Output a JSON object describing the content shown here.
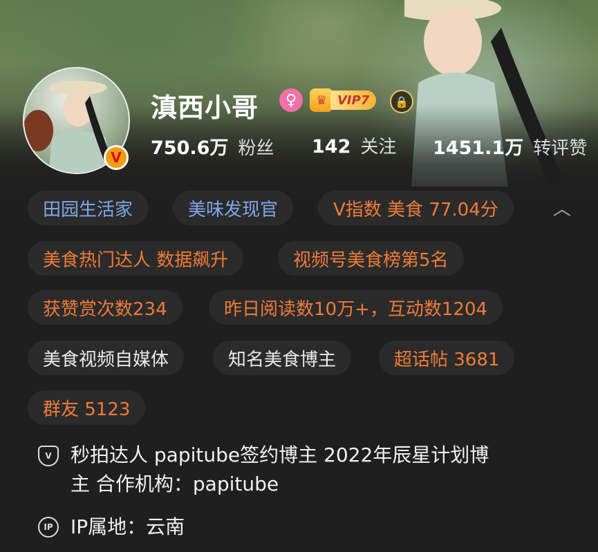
{
  "profile": {
    "name": "滇西小哥",
    "vip_level": "VIP7",
    "verified_badge": "V",
    "gender_icon": "female-icon"
  },
  "stats": [
    {
      "value": "750.6万",
      "label": "粉丝"
    },
    {
      "value": "142",
      "label": "关注"
    },
    {
      "value": "1451.1万",
      "label": "转评赞"
    }
  ],
  "tags": [
    {
      "text": "田园生活家",
      "color": "#7fa8e8"
    },
    {
      "text": "美味发现官",
      "color": "#7fa8e8"
    },
    {
      "text": "V指数 美食 77.04分",
      "color": "#f07c3a"
    },
    {
      "text": "美食热门达人 数据飙升",
      "color": "#f07c3a"
    },
    {
      "text": "视频号美食榜第5名",
      "color": "#f07c3a"
    },
    {
      "text": "获赞赏次数234",
      "color": "#f07c3a"
    },
    {
      "text": "昨日阅读数10万+，互动数1204",
      "color": "#f07c3a"
    },
    {
      "text": "美食视频自媒体",
      "color": "#eaeaea"
    },
    {
      "text": "知名美食博主",
      "color": "#eaeaea"
    },
    {
      "text": "超话帖 3681",
      "color": "#f07c3a"
    },
    {
      "text": "群友 5123",
      "color": "#f07c3a"
    }
  ],
  "collapse_icon": "chevron-up-icon",
  "certification": {
    "line1": "秒拍达人  papitube签约博主  2022年辰星计划博",
    "line2": "主 合作机构：papitube",
    "icon": "shield-v-icon"
  },
  "ip_location": {
    "text": "IP属地：云南",
    "icon_label": "IP"
  }
}
